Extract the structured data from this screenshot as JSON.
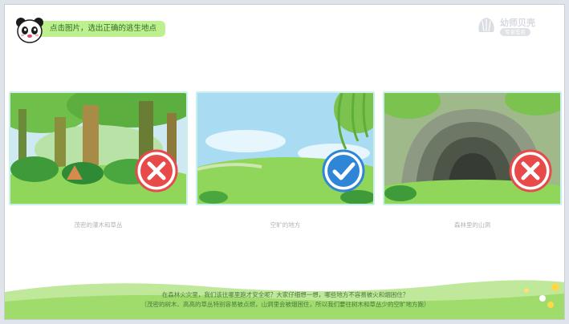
{
  "header": {
    "instruction": "点击图片，选出正确的逃生地点",
    "logo_title": "幼师贝壳",
    "logo_sub": "专享签名"
  },
  "options": [
    {
      "label": "茂密的灌木和草丛",
      "result": "wrong",
      "scene": "forest"
    },
    {
      "label": "空旷的地方",
      "result": "correct",
      "scene": "open-field"
    },
    {
      "label": "森林里的山洞",
      "result": "wrong",
      "scene": "cave"
    }
  ],
  "explanation": {
    "line1": "在森林火灾里，我们该往哪里跑才安全呢？大家仔细想一想，哪些地方不容易被火和烟困住？",
    "line2": "（茂密的树木、高高的草丛特别容易被点燃，山洞里会被烟困住，所以我们要往树木和草丛少的空旷地方跑）"
  },
  "colors": {
    "pill": "#bff08f",
    "card_border": "#c8f1ea",
    "wrong_badge": "#e84a4a",
    "correct_badge": "#2f86d6",
    "grass": "#8fd65a"
  }
}
